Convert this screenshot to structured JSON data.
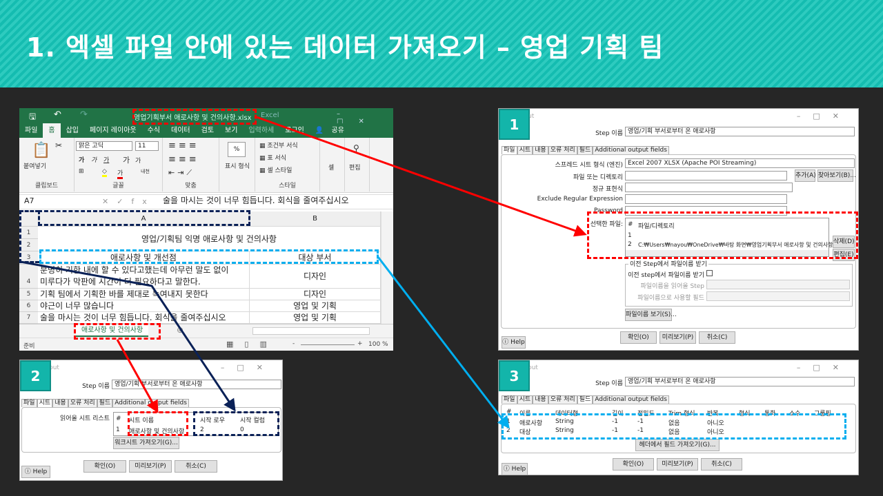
{
  "header": {
    "title": "1. 엑셀 파일 안에 있는 데이터 가져오기 – 영업 기획 팀",
    "bg_color": "#14bcb0"
  },
  "excel": {
    "window_title": "영업기획부서 애로사항 및 건의사항.xlsx",
    "app_name": "Excel",
    "tabs": [
      "파일",
      "홈",
      "삽입",
      "페이지 레이아웃",
      "수식",
      "데이터",
      "검토",
      "보기",
      "입력하세",
      "로그인",
      "공유"
    ],
    "ribbon": {
      "paste": "붙여넣기",
      "clipboard": "클립보드",
      "font_name": "맑은 고딕",
      "font_size": "11",
      "font_group": "글꼴",
      "align_group": "맞춤",
      "number_format": "표시 형식",
      "percent": "%",
      "cond_format": "조건부 서식",
      "table_format": "표 서식",
      "cell_style": "셀 스타일",
      "style_group": "스타일",
      "cells": "셀",
      "edit": "편집",
      "bold": "가",
      "italic": "가",
      "underline": "가",
      "grow": "가",
      "shrink": "가",
      "font_color": "가",
      "phonetic": "내천"
    },
    "name_box": "A7",
    "formula": "술을 마시는 것이 너무 힘듭니다. 회식을 줄여주십시오",
    "col_headers": [
      "A",
      "B"
    ],
    "rows": [
      {
        "n": "1",
        "a": "영업/기획팀 익명 애로사항 및 건의사항",
        "b": ""
      },
      {
        "n": "2",
        "a": "",
        "b": ""
      },
      {
        "n": "3",
        "a": "애로사항 및 개선점",
        "b": "대상 부서"
      },
      {
        "n": "4",
        "a": "분명히 기한 내에 할 수 있다고했는데 아무런 말도 없이",
        "a2": "미루다가 막판에 시간이 더 필요하다고 말한다.",
        "b": "디자인"
      },
      {
        "n": "5",
        "a": "기획 팀에서 기획한 바를 제대로 녹여내지 못한다",
        "b": "디자인"
      },
      {
        "n": "6",
        "a": "야근이 너무 많습니다",
        "b": "영업 및 기획"
      },
      {
        "n": "7",
        "a": "술을 마시는 것이 너무 힘듭니다. 회식을 줄여주십시오",
        "b": "영업 및 기획"
      }
    ],
    "sheet_tab": "애로사항 및 건의사항",
    "status": "준비",
    "zoom": "100 %",
    "zoom_minus": "-",
    "zoom_plus": "+"
  },
  "dialog1": {
    "badge": "1",
    "title_frag": "ut",
    "step_label": "Step 이름",
    "step_value": "영업/기획 부서로부터 온 애로사항",
    "tabs": [
      "파일",
      "시트",
      "내용",
      "오류 처리",
      "필드",
      "Additional output fields"
    ],
    "fields": {
      "format_label": "스프레드 시트 형식 (엔진)",
      "format_value": "Excel 2007 XLSX (Apache POI Streaming)",
      "file_label": "파일 또는 디렉토리",
      "regex_label": "정규 표현식",
      "exclude_label": "Exclude Regular Expression",
      "password_label": "Password",
      "selected_label": "선택한 파일:"
    },
    "buttons": {
      "add": "추가(A)",
      "browse": "찾아보기(B)...",
      "delete": "삭제(D)",
      "edit": "편집(E)",
      "show_files": "파일이름 보기(S)...",
      "ok": "확인(O)",
      "preview": "미리보기(P)",
      "cancel": "취소(C)",
      "help": "Help"
    },
    "file_table": {
      "headers": [
        "#",
        "파일/디렉토리"
      ],
      "rows": [
        [
          "1",
          ""
        ],
        [
          "2",
          "C:₩Users₩nayou₩OneDrive₩바탕 화면₩영업기획부서 애로사항 및 건의사항.xlsx"
        ]
      ]
    },
    "prev_step": {
      "group": "이전 Step에서 파일이름 받기",
      "checkbox": "이전 step에서 파일이름 받기",
      "read_step": "파일이름을 읽어올 Step",
      "field": "파일이름으로 사용할 필드"
    }
  },
  "dialog2": {
    "badge": "2",
    "title_frag": "put",
    "step_label": "Step 이름",
    "step_value": "영업/기획 부서로부터 온 애로사항",
    "tabs": [
      "파일",
      "시트",
      "내용",
      "오류 처리",
      "필드",
      "Additional output fields"
    ],
    "sheet_list_label": "읽어올 시트 리스트",
    "headers": [
      "#",
      "시트 이름",
      "시작 로우",
      "시작 컬럼"
    ],
    "rows": [
      [
        "1",
        "애로사항 및 건의사항",
        "2",
        "0"
      ]
    ],
    "buttons": {
      "get_sheets": "워크시트 가져오기(G)...",
      "ok": "확인(O)",
      "preview": "미리보기(P)",
      "cancel": "취소(C)",
      "help": "Help"
    }
  },
  "dialog3": {
    "badge": "3",
    "title_frag": "put",
    "step_label": "Step 이름",
    "step_value": "영업/기획 부서로부터 온 애로사항",
    "tabs": [
      "파일",
      "시트",
      "내용",
      "오류 처리",
      "필드",
      "Additional output fields"
    ],
    "headers": [
      "#",
      "이름",
      "데이터형",
      "길이",
      "정밀도",
      "Trim 형식",
      "반복",
      "형식",
      "통화",
      "소수",
      "그룹핑"
    ],
    "rows": [
      [
        "1",
        "애로사항",
        "String",
        "-1",
        "-1",
        "없음",
        "아니오"
      ],
      [
        "2",
        "대상",
        "String",
        "-1",
        "-1",
        "없음",
        "아니오"
      ]
    ],
    "buttons": {
      "get_fields": "헤더에서 필드 가져오기(G)...",
      "ok": "확인(O)",
      "preview": "미리보기(P)",
      "cancel": "취소(C)",
      "help": "Help"
    }
  },
  "colors": {
    "excel_green": "#217346",
    "badge": "#13b5aa",
    "red": "#ff0000",
    "navy": "#0a2157",
    "cyan": "#00aeef"
  }
}
